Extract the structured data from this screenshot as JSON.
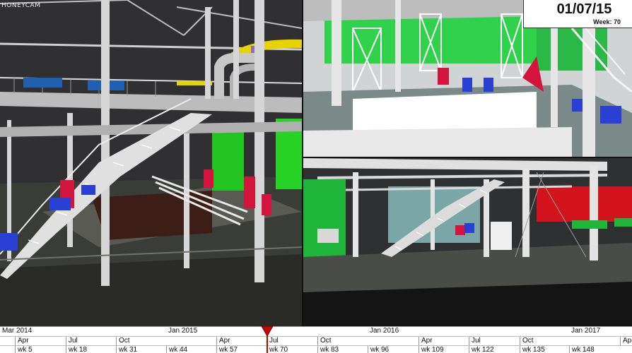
{
  "watermark": "HONEYCAM",
  "date_display": {
    "date": "01/07/15",
    "week": "Week: 70"
  },
  "timeline": {
    "years": [
      "Mar 2014",
      "Jan 2015",
      "Jan 2016",
      "Jan 2017"
    ],
    "quarters": [
      "Apr",
      "Jul",
      "Oct",
      "Apr",
      "Jul",
      "Oct",
      "Apr",
      "Jul",
      "Oct",
      "Apr"
    ],
    "weeks": [
      "wk 5",
      "wk 18",
      "wk 31",
      "wk 44",
      "wk 57",
      "wk 70",
      "wk 83",
      "wk 96",
      "wk 109",
      "wk 122",
      "wk 135",
      "wk 148"
    ],
    "current_week": "wk 70"
  },
  "viewports": [
    "main-3d-view",
    "top-right-3d-view",
    "bottom-right-3d-view"
  ],
  "colors": {
    "steel": "#d8d8d8",
    "pipe_green": "#22c422",
    "pump_red": "#d4143c",
    "motor_blue": "#2a3fd4",
    "pipe_yellow": "#e6d400",
    "playhead": "#cc0000"
  }
}
